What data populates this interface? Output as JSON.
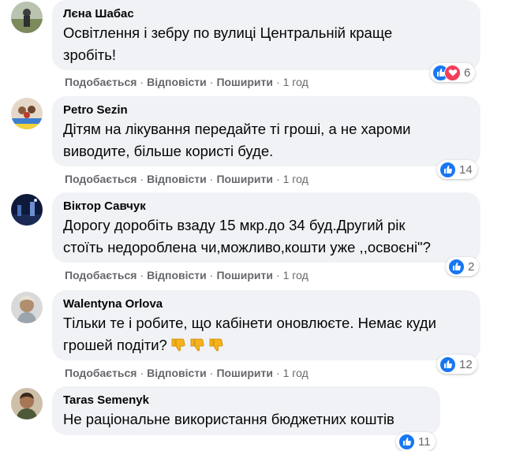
{
  "comments": [
    {
      "author": "Лєна Шабас",
      "lines": [
        "Освітлення і зебру по вулиці Центральній краще",
        "зробіть!"
      ],
      "reactions": {
        "types": [
          "like-icon",
          "love-icon"
        ],
        "count": "6"
      },
      "time": "1 год"
    },
    {
      "author": "Petro Sezin",
      "lines": [
        "Дітям на лікування передайте ті гроші, а не хароми",
        "виводите, більше користі буде."
      ],
      "reactions": {
        "types": [
          "like-icon"
        ],
        "count": "14"
      },
      "time": "1 год"
    },
    {
      "author": "Віктор Савчук",
      "lines": [
        "Дорогу доробіть взаду 15 мкр.до 34 буд.Другий рік",
        "стоїть недороблена чи,можливо,кошти уже ,,освоєні\"?"
      ],
      "reactions": {
        "types": [
          "like-icon"
        ],
        "count": "2"
      },
      "time": "1 год"
    },
    {
      "author": "Walentyna Orlova",
      "lines": [
        "Тільки те і робите, що кабінети оновлюєте. Немає куди",
        "грошей подіти?"
      ],
      "emoji": [
        "thumbs-down-icon",
        "thumbs-down-icon",
        "thumbs-down-icon"
      ],
      "reactions": {
        "types": [
          "like-icon"
        ],
        "count": "12"
      },
      "time": "1 год"
    },
    {
      "author": "Taras Semenyk",
      "lines": [
        "Не раціональне використання бюджетних коштів"
      ],
      "reactions": {
        "types": [
          "like-icon"
        ],
        "count": "11"
      },
      "time": ""
    }
  ],
  "actions": {
    "like": "Подобається",
    "reply": "Відповісти",
    "share": "Поширити",
    "sep": "·"
  },
  "colors": {
    "bubble": "#f0f2f5",
    "meta": "#65676b",
    "like": "#1877f2",
    "love": "#f33e58"
  }
}
